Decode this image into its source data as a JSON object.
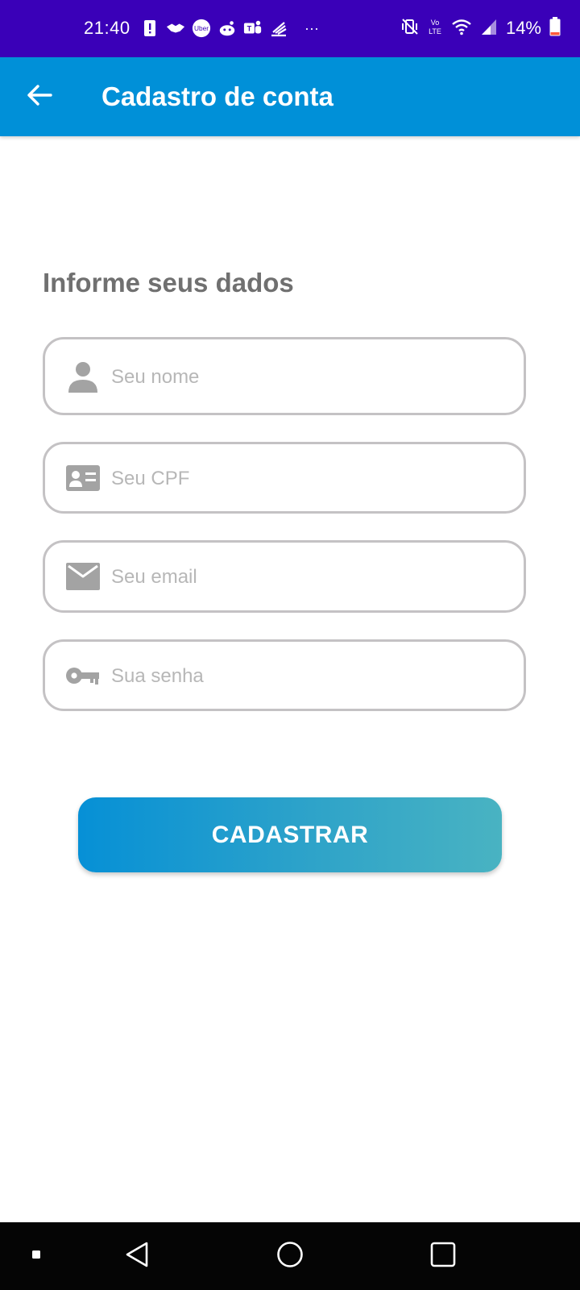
{
  "status_bar": {
    "time": "21:40",
    "more": "···",
    "battery": "14%",
    "notification_icons": [
      "alert-icon",
      "handshake-icon",
      "uber-icon",
      "reddit-icon",
      "teams-icon",
      "stack-icon"
    ],
    "system_icons": [
      "mute-vibrate-icon",
      "volte-icon",
      "wifi-icon",
      "signal-icon",
      "battery-icon"
    ],
    "volte_label": "Vo\nLTE"
  },
  "app_bar": {
    "title": "Cadastro de conta",
    "back_icon": "arrow-back-icon",
    "color": "#0090d8"
  },
  "form": {
    "heading": "Informe seus dados",
    "fields": [
      {
        "name": "name",
        "icon": "person-icon",
        "placeholder": "Seu nome"
      },
      {
        "name": "cpf",
        "icon": "id-card-icon",
        "placeholder": "Seu CPF"
      },
      {
        "name": "email",
        "icon": "mail-icon",
        "placeholder": "Seu email"
      },
      {
        "name": "password",
        "icon": "key-icon",
        "placeholder": "Sua senha"
      }
    ],
    "submit_label": "CADASTRAR"
  },
  "nav_bar": {
    "icons": [
      "recent-dot-icon",
      "back-triangle-icon",
      "home-circle-icon",
      "overview-square-icon"
    ]
  },
  "colors": {
    "status_bar": "#3a00b8",
    "accent": "#0090d8",
    "icon_gray": "#a3a3a3",
    "border_gray": "#c4c2c4"
  }
}
